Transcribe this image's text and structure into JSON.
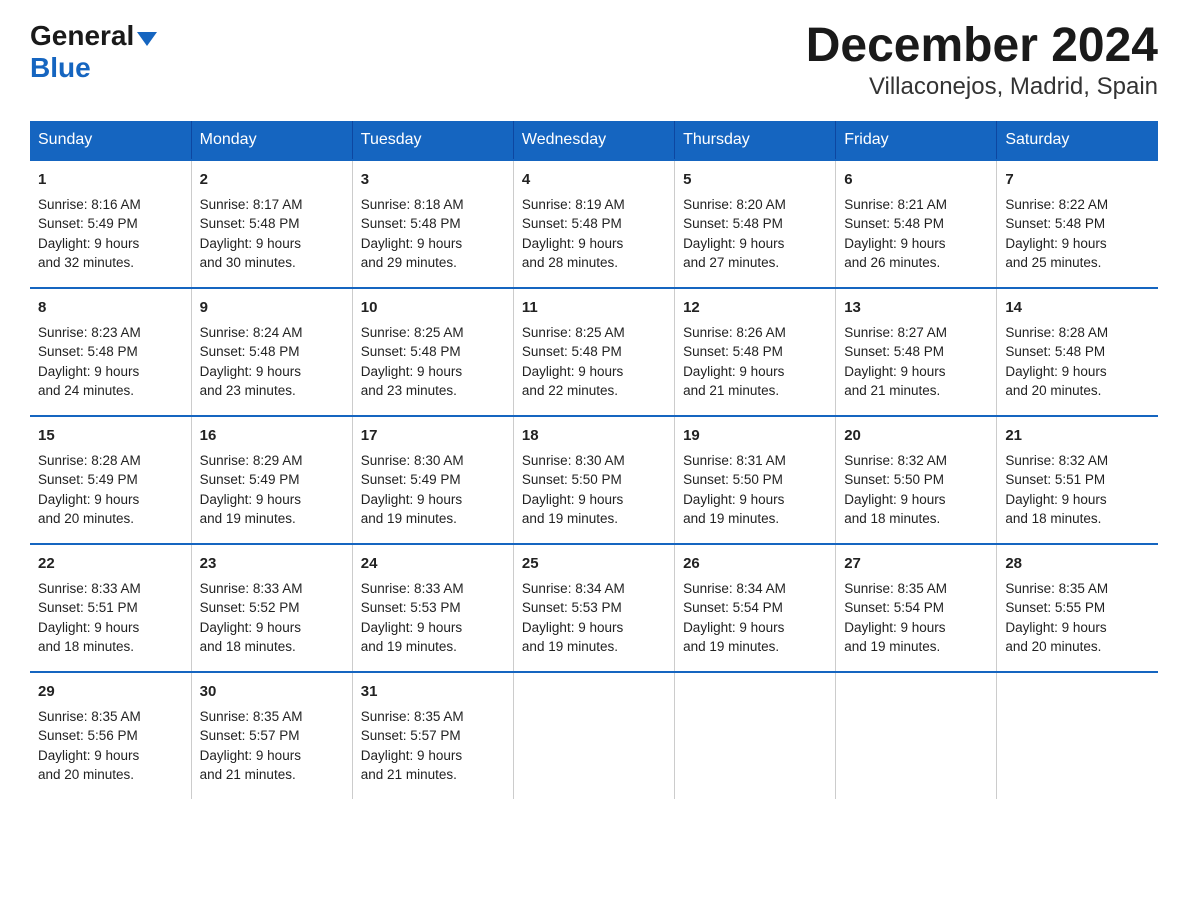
{
  "logo": {
    "line1": "General",
    "line2": "Blue"
  },
  "calendar": {
    "title": "December 2024",
    "subtitle": "Villaconejos, Madrid, Spain",
    "days_of_week": [
      "Sunday",
      "Monday",
      "Tuesday",
      "Wednesday",
      "Thursday",
      "Friday",
      "Saturday"
    ],
    "weeks": [
      [
        {
          "day": "1",
          "sunrise": "8:16 AM",
          "sunset": "5:49 PM",
          "daylight": "9 hours and 32 minutes."
        },
        {
          "day": "2",
          "sunrise": "8:17 AM",
          "sunset": "5:48 PM",
          "daylight": "9 hours and 30 minutes."
        },
        {
          "day": "3",
          "sunrise": "8:18 AM",
          "sunset": "5:48 PM",
          "daylight": "9 hours and 29 minutes."
        },
        {
          "day": "4",
          "sunrise": "8:19 AM",
          "sunset": "5:48 PM",
          "daylight": "9 hours and 28 minutes."
        },
        {
          "day": "5",
          "sunrise": "8:20 AM",
          "sunset": "5:48 PM",
          "daylight": "9 hours and 27 minutes."
        },
        {
          "day": "6",
          "sunrise": "8:21 AM",
          "sunset": "5:48 PM",
          "daylight": "9 hours and 26 minutes."
        },
        {
          "day": "7",
          "sunrise": "8:22 AM",
          "sunset": "5:48 PM",
          "daylight": "9 hours and 25 minutes."
        }
      ],
      [
        {
          "day": "8",
          "sunrise": "8:23 AM",
          "sunset": "5:48 PM",
          "daylight": "9 hours and 24 minutes."
        },
        {
          "day": "9",
          "sunrise": "8:24 AM",
          "sunset": "5:48 PM",
          "daylight": "9 hours and 23 minutes."
        },
        {
          "day": "10",
          "sunrise": "8:25 AM",
          "sunset": "5:48 PM",
          "daylight": "9 hours and 23 minutes."
        },
        {
          "day": "11",
          "sunrise": "8:25 AM",
          "sunset": "5:48 PM",
          "daylight": "9 hours and 22 minutes."
        },
        {
          "day": "12",
          "sunrise": "8:26 AM",
          "sunset": "5:48 PM",
          "daylight": "9 hours and 21 minutes."
        },
        {
          "day": "13",
          "sunrise": "8:27 AM",
          "sunset": "5:48 PM",
          "daylight": "9 hours and 21 minutes."
        },
        {
          "day": "14",
          "sunrise": "8:28 AM",
          "sunset": "5:48 PM",
          "daylight": "9 hours and 20 minutes."
        }
      ],
      [
        {
          "day": "15",
          "sunrise": "8:28 AM",
          "sunset": "5:49 PM",
          "daylight": "9 hours and 20 minutes."
        },
        {
          "day": "16",
          "sunrise": "8:29 AM",
          "sunset": "5:49 PM",
          "daylight": "9 hours and 19 minutes."
        },
        {
          "day": "17",
          "sunrise": "8:30 AM",
          "sunset": "5:49 PM",
          "daylight": "9 hours and 19 minutes."
        },
        {
          "day": "18",
          "sunrise": "8:30 AM",
          "sunset": "5:50 PM",
          "daylight": "9 hours and 19 minutes."
        },
        {
          "day": "19",
          "sunrise": "8:31 AM",
          "sunset": "5:50 PM",
          "daylight": "9 hours and 19 minutes."
        },
        {
          "day": "20",
          "sunrise": "8:32 AM",
          "sunset": "5:50 PM",
          "daylight": "9 hours and 18 minutes."
        },
        {
          "day": "21",
          "sunrise": "8:32 AM",
          "sunset": "5:51 PM",
          "daylight": "9 hours and 18 minutes."
        }
      ],
      [
        {
          "day": "22",
          "sunrise": "8:33 AM",
          "sunset": "5:51 PM",
          "daylight": "9 hours and 18 minutes."
        },
        {
          "day": "23",
          "sunrise": "8:33 AM",
          "sunset": "5:52 PM",
          "daylight": "9 hours and 18 minutes."
        },
        {
          "day": "24",
          "sunrise": "8:33 AM",
          "sunset": "5:53 PM",
          "daylight": "9 hours and 19 minutes."
        },
        {
          "day": "25",
          "sunrise": "8:34 AM",
          "sunset": "5:53 PM",
          "daylight": "9 hours and 19 minutes."
        },
        {
          "day": "26",
          "sunrise": "8:34 AM",
          "sunset": "5:54 PM",
          "daylight": "9 hours and 19 minutes."
        },
        {
          "day": "27",
          "sunrise": "8:35 AM",
          "sunset": "5:54 PM",
          "daylight": "9 hours and 19 minutes."
        },
        {
          "day": "28",
          "sunrise": "8:35 AM",
          "sunset": "5:55 PM",
          "daylight": "9 hours and 20 minutes."
        }
      ],
      [
        {
          "day": "29",
          "sunrise": "8:35 AM",
          "sunset": "5:56 PM",
          "daylight": "9 hours and 20 minutes."
        },
        {
          "day": "30",
          "sunrise": "8:35 AM",
          "sunset": "5:57 PM",
          "daylight": "9 hours and 21 minutes."
        },
        {
          "day": "31",
          "sunrise": "8:35 AM",
          "sunset": "5:57 PM",
          "daylight": "9 hours and 21 minutes."
        },
        null,
        null,
        null,
        null
      ]
    ]
  }
}
